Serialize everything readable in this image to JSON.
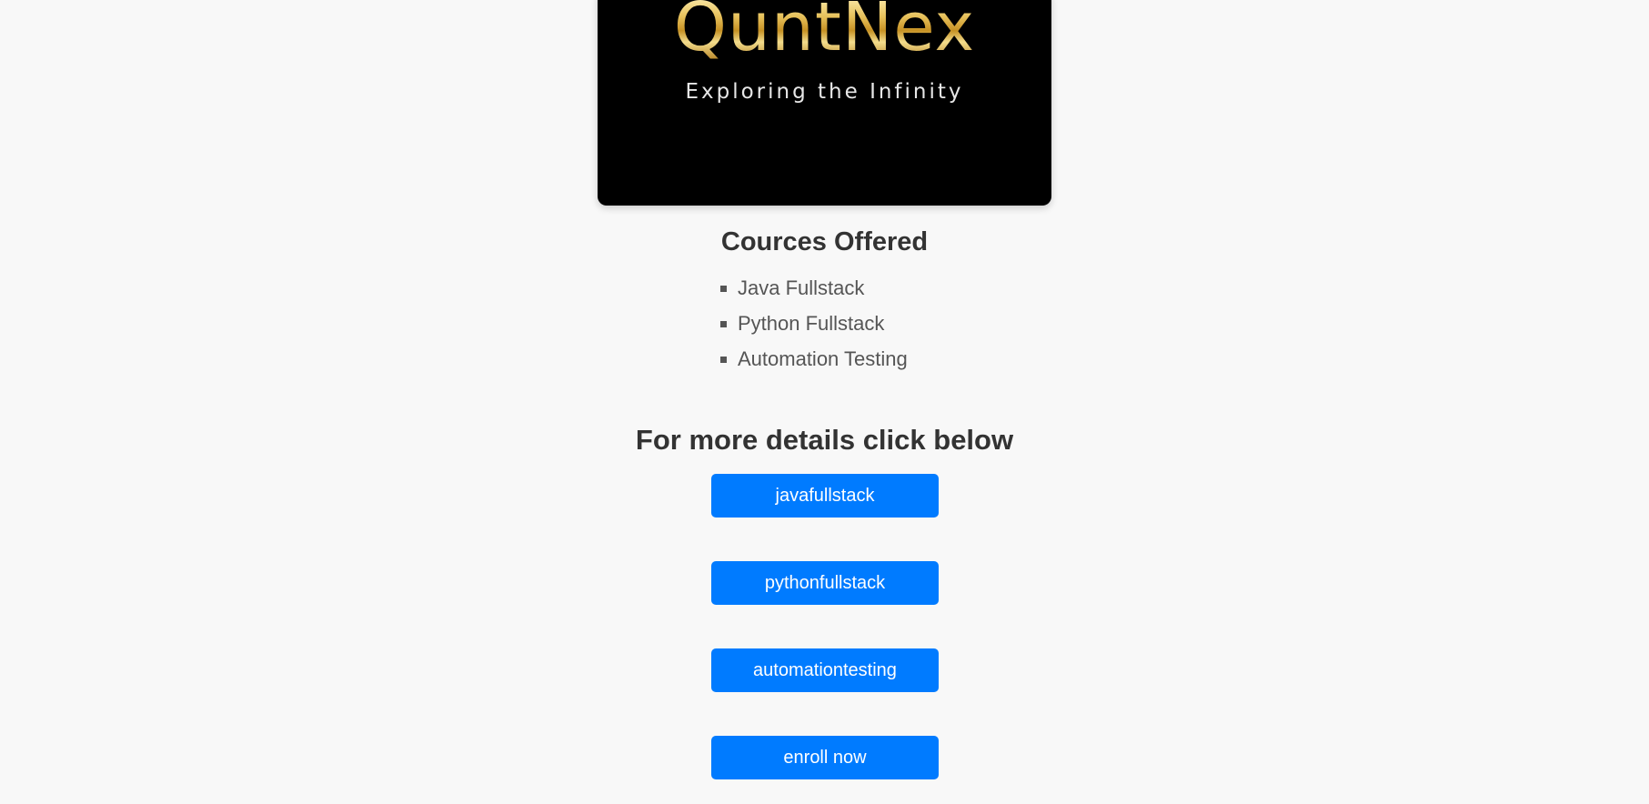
{
  "banner": {
    "logo": "QuntNex",
    "tagline": "Exploring the Infinity"
  },
  "courses": {
    "title": "Cources Offered",
    "items": [
      "Java Fullstack",
      "Python Fullstack",
      "Automation Testing"
    ]
  },
  "details": {
    "title": "For more details click below",
    "buttons": {
      "java": "javafullstack",
      "python": "pythonfullstack",
      "automation": "automationtesting",
      "enroll": "enroll now"
    }
  },
  "colors": {
    "background": "#f8f8f8",
    "button": "#007bff",
    "button_text": "#ffffff",
    "heading": "#333333",
    "banner": "#000000",
    "logo_gold": "#d4a53a"
  }
}
